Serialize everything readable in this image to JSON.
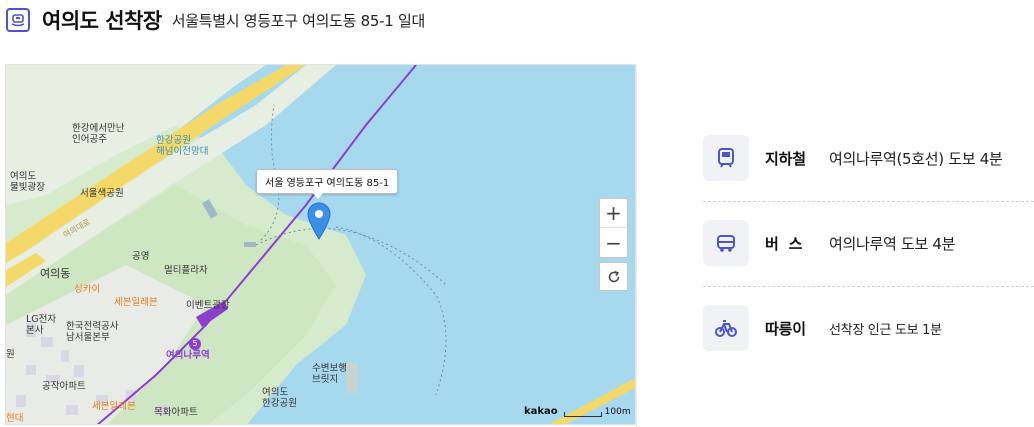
{
  "header": {
    "title": "여의도 선착장",
    "address": "서울특별시 영등포구 여의도동 85-1 일대"
  },
  "map": {
    "callout": "서울 영등포구 여의도동 85-1",
    "zoom_in": "+",
    "zoom_out": "−",
    "brand": "kakao",
    "scale_label": "100m",
    "labels": {
      "hangang_monument": "한강에서만난\n인어공주",
      "hangang_park_obs": "한강공원\n해넘이전망대",
      "yeouido_plaza": "여의도\n물빛광장",
      "saetgang": "서울색공원",
      "yeouido_road": "여의대로",
      "parking": "공영",
      "multiplaza": "멀티플라자",
      "yeouido_dong": "여의동",
      "singkai": "싱카이",
      "severance_1": "세븐일레븐",
      "event_plaza": "이벤트광장",
      "lg": "LG전자\n본사",
      "kepco": "한국전력공사\n남서울본부",
      "station": "여의나루역",
      "swim": "수변보행\n브릿지",
      "hangang_park": "여의도\n한강공원",
      "gongjak": "공작아파트",
      "severance_2": "세븐일레븐",
      "mokhwa": "목화아파트",
      "hyundai": "현대",
      "gu": "원",
      "lane": "5"
    }
  },
  "transport": [
    {
      "label": "지하철",
      "value": "여의나루역(5호선) 도보 4분",
      "icon": "subway-icon"
    },
    {
      "label": "버  스",
      "value": "여의나루역 도보 4분",
      "icon": "bus-icon"
    },
    {
      "label": "따릉이",
      "value": "선착장 인근 도보 1분",
      "icon": "bicycle-icon"
    }
  ],
  "colors": {
    "accent": "#4a56c9",
    "water": "#a6d8ee",
    "park": "#cfe8c3",
    "subway_line": "#8a3fd1"
  }
}
